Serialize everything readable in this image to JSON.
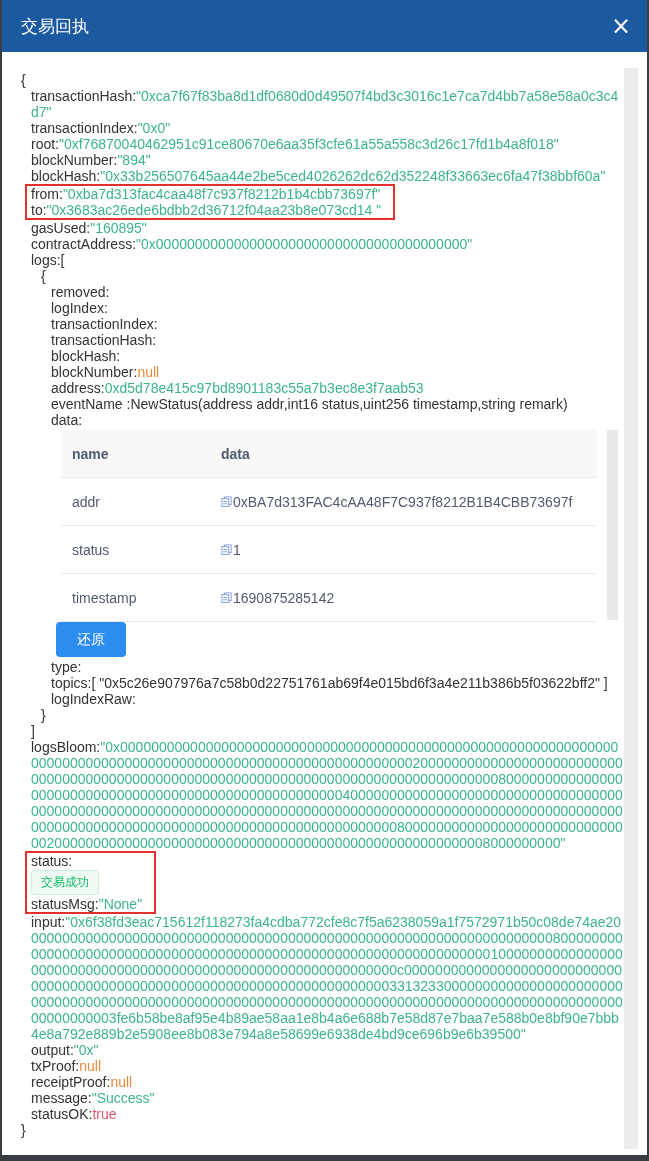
{
  "dialog": {
    "title": "交易回执",
    "close": "×"
  },
  "receipt": {
    "open": "{",
    "close": "}",
    "fields": [
      {
        "key": "transactionHash:",
        "kind": "string",
        "value": "\"0xca7f67f83ba8d1df0680d0d49507f4bd3c3016c1e7ca7d4bb7a58e58a0c3c4d7\""
      },
      {
        "key": "transactionIndex:",
        "kind": "string",
        "value": "\"0x0\""
      },
      {
        "key": "root:",
        "kind": "string",
        "value": "\"0xf76870040462951c91ce80670e6aa35f3cfe61a55a558c3d26c17fd1b4a8f018\""
      },
      {
        "key": "blockNumber:",
        "kind": "string",
        "value": "\"894\""
      },
      {
        "key": "blockHash:",
        "kind": "string",
        "value": "\"0x33b256507645aa44e2be5ced4026262dc62d352248f33663ec6fa47f38bbf60a\""
      },
      {
        "kind": "group",
        "fields": [
          {
            "key": "from:",
            "kind": "string",
            "value": "\"0xba7d313fac4caa48f7c937f8212b1b4cbb73697f\""
          },
          {
            "key": "to:",
            "kind": "string",
            "value": "\"0x3683ac26ede6bdbb2d36712f04aa23b8e073cd14 \""
          }
        ]
      },
      {
        "key": "gasUsed:",
        "kind": "string",
        "value": "\"160895\""
      },
      {
        "key": "contractAddress:",
        "kind": "string",
        "value": "\"0x0000000000000000000000000000000000000000\""
      },
      {
        "key": "logs:[",
        "kind": "logs",
        "close": "]",
        "items": [
          {
            "open": "{",
            "close": "}",
            "fields": [
              {
                "key": "removed:",
                "kind": "plain"
              },
              {
                "key": "logIndex:",
                "kind": "plain"
              },
              {
                "key": "transactionIndex:",
                "kind": "plain"
              },
              {
                "key": "transactionHash:",
                "kind": "plain"
              },
              {
                "key": "blockHash:",
                "kind": "plain"
              },
              {
                "key": "blockNumber:",
                "kind": "null",
                "value": "null"
              },
              {
                "key": "address:",
                "kind": "string",
                "value": "0xd5d78e415c97bd8901183c55a7b3ec8e3f7aab53"
              },
              {
                "key": "eventName :",
                "kind": "plain",
                "value": "NewStatus(address addr,int16 status,uint256 timestamp,string remark)"
              },
              {
                "key": "data:",
                "kind": "table",
                "columns": [
                  "name",
                  "data"
                ],
                "rows": [
                  {
                    "name": "addr",
                    "data": "0xBA7d313FAC4cAA48F7C937f8212B1B4CBB73697f"
                  },
                  {
                    "name": "status",
                    "data": "1"
                  },
                  {
                    "name": "timestamp",
                    "data": "1690875285142"
                  }
                ],
                "button": "还原"
              },
              {
                "key": "type:",
                "kind": "plain"
              },
              {
                "key": "topics:",
                "kind": "plain",
                "value": "[ \"0x5c26e907976a7c58b0d22751761ab69f4e015bd6f3a4e211b386b5f03622bff2\" ]"
              },
              {
                "key": "logIndexRaw:",
                "kind": "plain"
              }
            ]
          }
        ]
      },
      {
        "key": "logsBloom:",
        "kind": "string",
        "value": "\"0x00000000000000000000000000000000000000000000000000000000000000000000000000000000000000000000000000000000000000000200000000000000000000000000000000000000000000000000000000000000000000000000000000000000800000000000000000000000000000000000000000000000000000004000000000000000000000000000000000000000000000000000000000000000000000000000000000000000000000000000000000000000000000000000000000000000000000000000000000000008000000000000000000000000000000200000000000000000000000000000000000000000000000000000008000000000\""
      },
      {
        "kind": "group",
        "fields": [
          {
            "key": "status:",
            "kind": "tag",
            "value": "交易成功"
          },
          {
            "key": "statusMsg:",
            "kind": "string",
            "value": "\"None\""
          }
        ]
      },
      {
        "key": "input:",
        "kind": "string",
        "value": "\"0x6f38fd3eac715612f118273fa4cdba772cfe8c7f5a6238059a1f7572971b50c08de74ae200000000000000000000000000000000000000000000000000000000000000000000800000000000000000000000000000000000000000000000000000000000000000001000000000000000000000000000000000000000000000000000000000000000c00000000000000000000000000000000000000000000000000000000000000000000000000331323300000000000000000000000000000000000000000000000000000000000000000000000000000000000000000000000000000000000003fe6b58be8af95e4b89ae58aa1e8b4a6e688b7e58d87e7baa7e588b0e8bf90e7bbb4e8a792e889b2e5908ee8b083e794a8e58699e6938de4bd9ce696b9e6b39500\""
      },
      {
        "key": "output:",
        "kind": "string",
        "value": "\"0x\""
      },
      {
        "key": "txProof:",
        "kind": "null",
        "value": "null"
      },
      {
        "key": "receiptProof:",
        "kind": "null",
        "value": "null"
      },
      {
        "key": "message:",
        "kind": "string",
        "value": "\"Success\""
      },
      {
        "key": "statusOK:",
        "kind": "bool",
        "value": "true"
      }
    ]
  }
}
